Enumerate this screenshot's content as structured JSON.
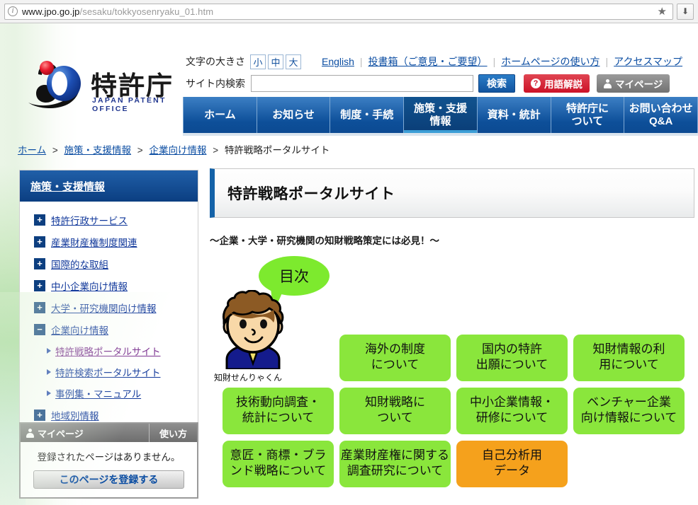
{
  "browser": {
    "url_prefix": "www.jpo.go.jp",
    "url_path": "/sesaku/tokkyosenryaku_01.htm",
    "info_icon": "info-icon",
    "star_icon": "★",
    "download_icon": "⬇"
  },
  "header": {
    "logo_text": "特許庁",
    "logo_sub": "JAPAN PATENT OFFICE",
    "text_size_label": "文字の大きさ",
    "size_buttons": [
      "小",
      "中",
      "大"
    ],
    "links": [
      "English",
      "投書箱（ご意見・ご要望）",
      "ホームページの使い方",
      "アクセスマップ"
    ],
    "search_label": "サイト内検索",
    "search_value": "",
    "search_placeholder": "",
    "search_button": "検索",
    "glossary_button": "用語解説",
    "mypage_button": "マイページ"
  },
  "globalnav": {
    "items": [
      {
        "label": "ホーム",
        "active": false
      },
      {
        "label": "お知らせ",
        "active": false
      },
      {
        "label": "制度・手続",
        "active": false
      },
      {
        "label": "施策・支援\n情報",
        "line1": "施策・支援",
        "line2": "情報",
        "active": true
      },
      {
        "label": "資料・統計",
        "active": false
      },
      {
        "label": "特許庁に\nついて",
        "line1": "特許庁に",
        "line2": "ついて",
        "active": false
      },
      {
        "label": "お問い合わせ\nQ&A",
        "line1": "お問い合わせ",
        "line2": "Q&A",
        "active": false
      }
    ]
  },
  "breadcrumb": {
    "items": [
      "ホーム",
      "施策・支援情報",
      "企業向け情報",
      "特許戦略ポータルサイト"
    ],
    "separator": ">"
  },
  "sidebar": {
    "title": "施策・支援情報",
    "items": [
      {
        "toggle": "+",
        "label": "特許行政サービス"
      },
      {
        "toggle": "+",
        "label": "産業財産権制度関連"
      },
      {
        "toggle": "+",
        "label": "国際的な取組"
      },
      {
        "toggle": "+",
        "label": "中小企業向け情報"
      },
      {
        "toggle": "+",
        "label": "大学・研究機関向け情報"
      },
      {
        "toggle": "−",
        "label": "企業向け情報"
      }
    ],
    "subitems": [
      {
        "label": "特許戦略ポータルサイト",
        "visited": true
      },
      {
        "label": "特許検索ポータルサイト",
        "visited": false
      },
      {
        "label": "事例集・マニュアル",
        "visited": false
      }
    ],
    "last_item": {
      "toggle": "+",
      "label": "地域別情報"
    }
  },
  "mypage": {
    "title": "マイページ",
    "howto": "使い方",
    "empty_message": "登録されたページはありません。",
    "register_button": "このページを登録する"
  },
  "main": {
    "page_title": "特許戦略ポータルサイト",
    "lead_text": "～企業・大学・研究機関の知財戦略策定には必見！～",
    "mascot": {
      "bubble_text": "目次",
      "name": "知財せんりゃくん"
    },
    "tiles": [
      {
        "row": 1,
        "col": 1,
        "empty": true
      },
      {
        "row": 1,
        "col": 2,
        "line1": "海外の制度",
        "line2": "について",
        "color": "green"
      },
      {
        "row": 1,
        "col": 3,
        "line1": "国内の特許",
        "line2": "出願について",
        "color": "green"
      },
      {
        "row": 1,
        "col": 4,
        "line1": "知財情報の利",
        "line2": "用について",
        "color": "green"
      },
      {
        "row": 2,
        "col": 1,
        "line1": "技術動向調査・",
        "line2": "統計について",
        "color": "green"
      },
      {
        "row": 2,
        "col": 2,
        "line1": "知財戦略に",
        "line2": "ついて",
        "color": "green"
      },
      {
        "row": 2,
        "col": 3,
        "line1": "中小企業情報・",
        "line2": "研修について",
        "color": "green"
      },
      {
        "row": 2,
        "col": 4,
        "line1": "ベンチャー企業",
        "line2": "向け情報について",
        "color": "green"
      },
      {
        "row": 3,
        "col": 1,
        "line1": "意匠・商標・ブラ",
        "line2": "ンド戦略について",
        "color": "green"
      },
      {
        "row": 3,
        "col": 2,
        "line1": "産業財産権に関する",
        "line2": "調査研究について",
        "color": "green"
      },
      {
        "row": 3,
        "col": 3,
        "line1": "自己分析用",
        "line2": "データ",
        "color": "orange"
      }
    ]
  },
  "colors": {
    "nav_blue": "#0d4f99",
    "accent_blue": "#1462a8",
    "link_blue": "#12399b",
    "visited_purple": "#7a2f8f",
    "tile_green": "#8ae63c",
    "tile_orange": "#f5a11c",
    "bubble_green": "#7dea2e",
    "red_button": "#cc1227"
  }
}
